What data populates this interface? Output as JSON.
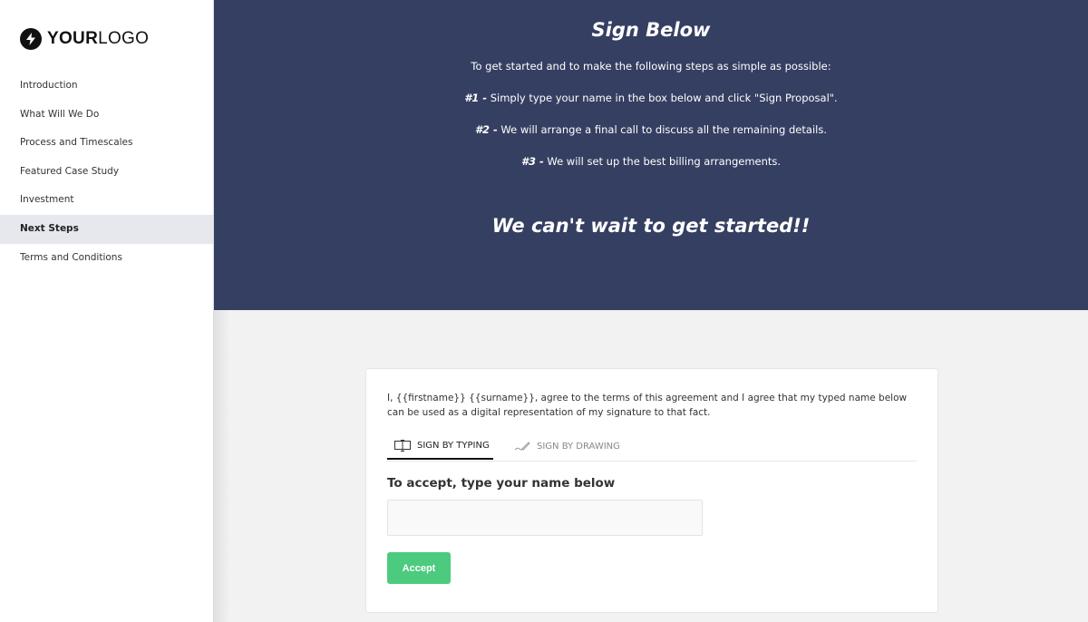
{
  "sidebar": {
    "logo": {
      "bold": "YOUR",
      "light": "LOGO"
    },
    "items": [
      {
        "label": "Introduction",
        "active": false
      },
      {
        "label": "What Will We Do",
        "active": false
      },
      {
        "label": "Process and Timescales",
        "active": false
      },
      {
        "label": "Featured Case Study",
        "active": false
      },
      {
        "label": "Investment",
        "active": false
      },
      {
        "label": "Next Steps",
        "active": true
      },
      {
        "label": "Terms and Conditions",
        "active": false
      }
    ]
  },
  "hero": {
    "title": "Sign Below",
    "intro": "To get started and to make the following steps as simple as possible:",
    "steps": [
      {
        "num": "#1 -",
        "text": " Simply type your name in the box below and click \"Sign Proposal\"."
      },
      {
        "num": "#2 -",
        "text": " We will arrange a final call to discuss all the remaining details."
      },
      {
        "num": "#3 -",
        "text": " We will set up the best billing arrangements."
      }
    ],
    "cta": "We can't wait to get started!!"
  },
  "signature": {
    "agreement": "I, {{firstname}} {{surname}}, agree to the terms of this agreement and I agree that my typed name below can be used as a digital representation of my signature to that fact.",
    "tabs": [
      {
        "label": "SIGN BY TYPING",
        "icon": "text-cursor-icon",
        "active": true
      },
      {
        "label": "SIGN BY DRAWING",
        "icon": "pen-icon",
        "active": false
      }
    ],
    "accept_label": "To accept, type your name below",
    "input_value": "",
    "input_placeholder": "",
    "accept_button": "Accept"
  },
  "colors": {
    "hero_bg": "#353f62",
    "accent_green": "#4ccb7e",
    "active_nav_bg": "#e7e8ee"
  }
}
